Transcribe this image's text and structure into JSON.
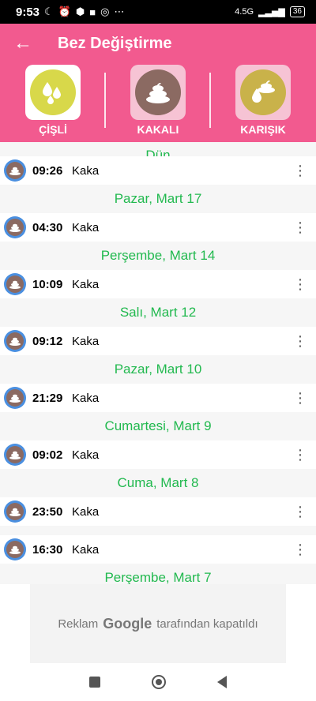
{
  "status": {
    "time": "9:53",
    "battery": "36",
    "network": "4.5G",
    "icons": [
      "moon-icon",
      "alarm-icon",
      "cube-icon",
      "square-icon",
      "instagram-icon",
      "more-dots-icon"
    ]
  },
  "appbar": {
    "title": "Bez Değiştirme"
  },
  "types": [
    {
      "label": "ÇİŞLİ",
      "icon": "wet-drops-icon",
      "box_color": "#ffffff"
    },
    {
      "label": "KAKALI",
      "icon": "poop-icon",
      "box_color": "#f6c3d4"
    },
    {
      "label": "KARIŞIK",
      "icon": "mixed-icon",
      "box_color": "#f6c3d4"
    }
  ],
  "list": {
    "partial_header": "Dün",
    "groups": [
      {
        "date": "",
        "rows": [
          {
            "time": "09:26",
            "kind": "Kaka"
          }
        ]
      },
      {
        "date": "Pazar, Mart 17",
        "rows": [
          {
            "time": "04:30",
            "kind": "Kaka"
          }
        ]
      },
      {
        "date": "Perşembe, Mart 14",
        "rows": [
          {
            "time": "10:09",
            "kind": "Kaka"
          }
        ]
      },
      {
        "date": "Salı, Mart 12",
        "rows": [
          {
            "time": "09:12",
            "kind": "Kaka"
          }
        ]
      },
      {
        "date": "Pazar, Mart 10",
        "rows": [
          {
            "time": "21:29",
            "kind": "Kaka"
          }
        ]
      },
      {
        "date": "Cumartesi, Mart 9",
        "rows": [
          {
            "time": "09:02",
            "kind": "Kaka"
          }
        ]
      },
      {
        "date": "Cuma, Mart 8",
        "rows": [
          {
            "time": "23:50",
            "kind": "Kaka"
          },
          {
            "time": "16:30",
            "kind": "Kaka"
          }
        ]
      },
      {
        "date": "Perşembe, Mart 7",
        "rows": []
      }
    ]
  },
  "ad": {
    "prefix": "Reklam",
    "brand": "Google",
    "suffix": "tarafından kapatıldı"
  },
  "colors": {
    "header": "#f25a8f",
    "date_green": "#22b94f",
    "avatar_blue": "#4a8fe0"
  }
}
